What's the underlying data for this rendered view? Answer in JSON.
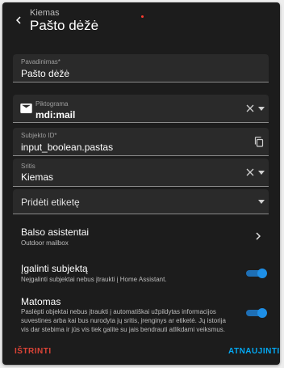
{
  "header": {
    "breadcrumb": "Kiemas",
    "title": "Pašto dėžė"
  },
  "fields": {
    "name": {
      "label": "Pavadinimas*",
      "value": "Pašto dėžė"
    },
    "icon": {
      "label": "Piktograma",
      "value": "mdi:mail",
      "icon": "mail-icon"
    },
    "entity_id": {
      "label": "Subjekto ID*",
      "value": "input_boolean.pastas"
    },
    "area": {
      "label": "Sritis",
      "value": "Kiemas"
    },
    "labels": {
      "placeholder": "Pridėti etiketę"
    }
  },
  "voice": {
    "title": "Balso asistentai",
    "subtitle": "Outdoor mailbox"
  },
  "enable": {
    "title": "Įgalinti subjektą",
    "description": "Neįgalinti subjektai nebus įtraukti į Home Assistant.",
    "enabled": true
  },
  "visible": {
    "title": "Matomas",
    "description": "Paslėpti objektai nebus įtraukti į automatiškai užpildytas informacijos suvestines arba kai bus nurodyta jų sritis, įrenginys ar etiketė. Jų istorija vis dar stebima ir jūs vis tiek galite su jais bendrauti atlikdami veiksmus.",
    "enabled": true
  },
  "actions": {
    "delete": "IŠTRINTI",
    "update": "ATNAUJINTI"
  },
  "colors": {
    "danger": "#db4437",
    "primary": "#03a9f4",
    "toggle": "#1e8fe6"
  }
}
